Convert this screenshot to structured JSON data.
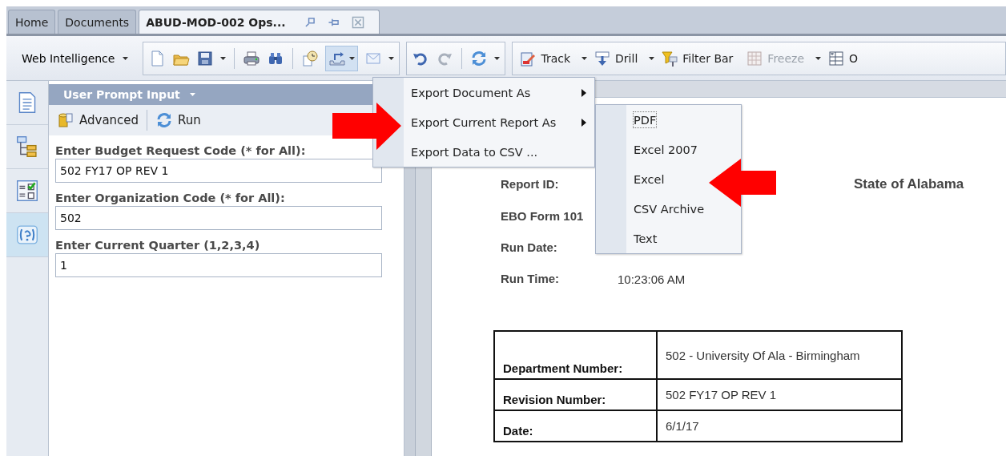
{
  "tabs": [
    {
      "label": "Home",
      "selected": false
    },
    {
      "label": "Documents",
      "selected": false
    },
    {
      "label": "ABUD-MOD-002 Ops...",
      "selected": true
    }
  ],
  "toolbar": {
    "app_menu": "Web Intelligence",
    "export_pressed": true,
    "items": [
      {
        "label": "Track",
        "kind": "track",
        "disabled": false,
        "dropdown": true
      },
      {
        "label": "Drill",
        "kind": "drill",
        "disabled": false,
        "dropdown": true
      },
      {
        "label": "Filter Bar",
        "kind": "filter",
        "disabled": false,
        "dropdown": false
      },
      {
        "label": "Freeze",
        "kind": "freeze",
        "disabled": true,
        "dropdown": true
      },
      {
        "label": "O",
        "kind": "outline",
        "disabled": false,
        "dropdown": false
      }
    ]
  },
  "side_rail": [
    {
      "kind": "document",
      "selected": false
    },
    {
      "kind": "tree",
      "selected": false
    },
    {
      "kind": "checklist",
      "selected": false
    },
    {
      "kind": "help",
      "selected": true
    }
  ],
  "prompt_panel": {
    "title": "User Prompt Input",
    "actions": [
      {
        "label": "Advanced",
        "kind": "advanced"
      },
      {
        "label": "Run",
        "kind": "run"
      }
    ],
    "prompts": [
      {
        "label": "Enter Budget Request Code (* for All):",
        "value": "502 FY17 OP REV 1"
      },
      {
        "label": "Enter Organization Code (* for All):",
        "value": "502"
      },
      {
        "label": "Enter Current Quarter (1,2,3,4)",
        "value": "1"
      }
    ]
  },
  "export_menu": {
    "items": [
      {
        "label": "Export Document As",
        "submenu": true
      },
      {
        "label": "Export Current Report As",
        "submenu": true
      },
      {
        "label": "Export Data to CSV ...",
        "submenu": false
      }
    ]
  },
  "export_submenu": {
    "items": [
      {
        "label": "PDF",
        "focused": true
      },
      {
        "label": "Excel 2007",
        "focused": false
      },
      {
        "label": "Excel",
        "focused": false
      },
      {
        "label": "CSV Archive",
        "focused": false
      },
      {
        "label": "Text",
        "focused": false
      }
    ]
  },
  "report": {
    "title": "State of Alabama",
    "header_fields": [
      {
        "label": "Report ID:"
      },
      {
        "label": "EBO Form 101"
      },
      {
        "label": "Run Date:"
      },
      {
        "label": "Run Time:",
        "value": "10:23:06 AM"
      }
    ],
    "table": [
      {
        "label": "Department Number:",
        "value": "502 - University Of Ala - Birmingham"
      },
      {
        "label": "Revision Number:",
        "value": "502 FY17 OP REV 1"
      },
      {
        "label": "Date:",
        "value": "6/1/17"
      }
    ]
  }
}
